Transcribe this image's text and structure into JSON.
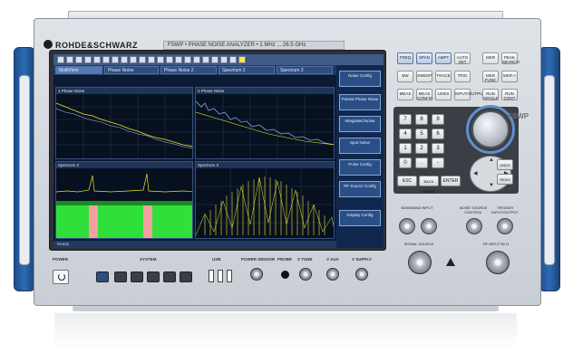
{
  "brand": "ROHDE&SCHWARZ",
  "model_plate": "FSWP • PHASE NOISE ANALYZER • 1 MHz ... 26.5 GHz",
  "side_model": "FSWP",
  "screen": {
    "tabs": [
      "MultiView",
      "Phase Noise",
      "Phase Noise 2",
      "Spectrum 2",
      "Spectrum 3"
    ],
    "windows": [
      {
        "title": "1 Phase Noise"
      },
      {
        "title": "2 Phase Noise"
      },
      {
        "title": "Spectrum 2"
      },
      {
        "title": "Spectrum 3"
      }
    ],
    "softkeys": [
      "Noise Config",
      "Pulsed Phase Noise",
      "Integrated Noise",
      "Spot Noise",
      "Pulse Config",
      "RF Source Config",
      "Display Config"
    ],
    "status": "Ready"
  },
  "keys": {
    "row1": [
      "FREQ",
      "SPAN",
      "AMPT",
      "AUTO SET",
      "MKR",
      "PEAK SEARCH"
    ],
    "row2": [
      "BW",
      "SWEEP",
      "TRACE",
      "TRIG",
      "MKR FUNC",
      "MKR->"
    ],
    "row3": [
      "MEAS",
      "MEAS CONFIG",
      "LINES",
      "INPUT/OUTPUT",
      "RUN SINGLE",
      "RUN CONT"
    ],
    "numpad": [
      "7",
      "8",
      "9",
      "4",
      "5",
      "6",
      "1",
      "2",
      "3",
      "0",
      ".",
      "-"
    ],
    "action": [
      "ESC",
      "BACK SPACE",
      "ENTER"
    ],
    "side": [
      "UNDO",
      "REDO"
    ]
  },
  "front_labels": {
    "power": "POWER",
    "system": "SYSTEM",
    "usb": "USB",
    "power_sensor": "POWER SENSOR",
    "probe": "PROBE",
    "v_tune": "V TUNE",
    "v_aux": "V AUX",
    "v_supply": "V SUPPLY",
    "baseband": "BASEBAND INPUT",
    "noise_source": "NOISE SOURCE CONTROL",
    "trigger": "TRIGGER INPUT/OUTPUT",
    "signal_source": "SIGNAL SOURCE",
    "rf_input": "RF INPUT 50 Ω"
  },
  "colors": {
    "accent": "#2d6bb5",
    "trace_yellow": "#e8e62a",
    "trace_blue": "#7fa8e8",
    "spectrogram_green": "#2fe03a",
    "spectrogram_pink": "#f4a0a0"
  }
}
